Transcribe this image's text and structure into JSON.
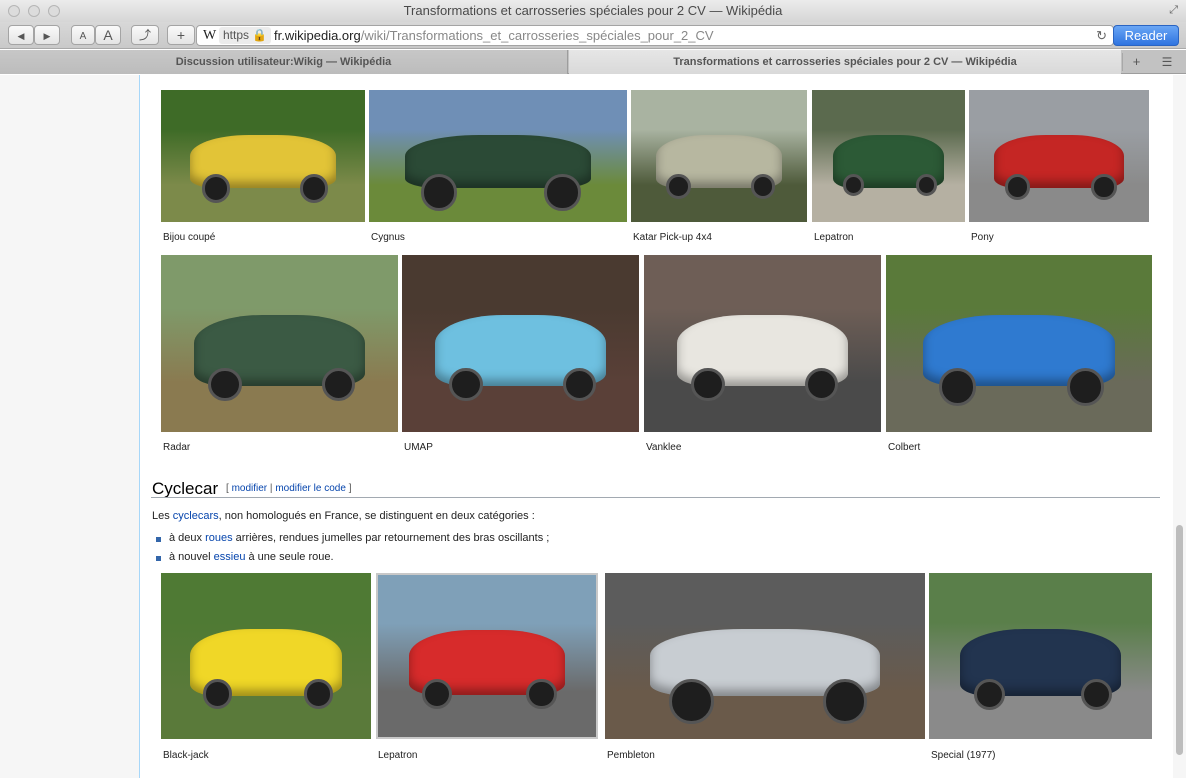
{
  "window": {
    "title": "Transformations et carrosseries spéciales pour 2 CV — Wikipédia"
  },
  "toolbar": {
    "back_icon": "◀",
    "forward_icon": "▶",
    "font_smaller": "A",
    "font_larger": "A",
    "share_icon": "⤴",
    "add_icon": "+",
    "url_site_icon": "W",
    "url_https": "https 🔒",
    "url_domain": "fr.wikipedia.org",
    "url_path": "/wiki/Transformations_et_carrosseries_spéciales_pour_2_CV",
    "reload_icon": "↻",
    "reader_label": "Reader"
  },
  "tabs": [
    {
      "label": "Discussion utilisateur:Wikig — Wikipédia",
      "active": false
    },
    {
      "label": "Transformations et carrosseries spéciales pour 2 CV — Wikipédia",
      "active": true
    }
  ],
  "tabbar": {
    "add_icon": "+",
    "list_icon": "☰"
  },
  "gallery_top": [
    {
      "caption": "Bijou coupé",
      "colors": [
        "#3e6b27",
        "#e2c437",
        "#7c8a4a"
      ]
    },
    {
      "caption": "Cygnus",
      "colors": [
        "#6f8fb6",
        "#2b4a36",
        "#6b8a3a"
      ]
    },
    {
      "caption": "Katar Pick-up 4x4",
      "colors": [
        "#a9b3a1",
        "#b7b7a0",
        "#4e5a3a"
      ]
    },
    {
      "caption": "Lepatron",
      "colors": [
        "#5b6a4e",
        "#2c5a36",
        "#b5b0a2"
      ]
    },
    {
      "caption": "Pony",
      "colors": [
        "#9a9ea3",
        "#c52624",
        "#8a8a8a"
      ]
    }
  ],
  "gallery_mid": [
    {
      "caption": "Radar",
      "colors": [
        "#7f9a6a",
        "#3b5a44",
        "#8a7a50"
      ]
    },
    {
      "caption": "UMAP",
      "colors": [
        "#4a3a30",
        "#6ec0e0",
        "#5a4038"
      ]
    },
    {
      "caption": "Vanklee",
      "colors": [
        "#6e5e56",
        "#e8e6e0",
        "#4a4a4a"
      ]
    },
    {
      "caption": "Colbert",
      "colors": [
        "#5a7a3a",
        "#2f7ad0",
        "#6a6a5a"
      ]
    }
  ],
  "section": {
    "heading": "Cyclecar",
    "edit_open": "[",
    "edit_modifier": "modifier",
    "edit_sep": "|",
    "edit_code": "modifier le code",
    "edit_close": "]",
    "intro_pre": "Les ",
    "intro_link": "cyclecars",
    "intro_post": ", non homologués en France, se distinguent en deux catégories :",
    "bullets": [
      {
        "pre": "à deux ",
        "link": "roues",
        "post": " arrières, rendues jumelles par retournement des bras oscillants ;"
      },
      {
        "pre": "à nouvel ",
        "link": "essieu",
        "post": " à une seule roue."
      }
    ]
  },
  "gallery_bottom": [
    {
      "caption": "Black-jack",
      "colors": [
        "#4f7a34",
        "#f0d727",
        "#5a7a3a"
      ]
    },
    {
      "caption": "Lepatron",
      "colors": [
        "#7fa0b8",
        "#d72b2b",
        "#6a6a6a"
      ]
    },
    {
      "caption": "Pembleton",
      "colors": [
        "#5c5c5c",
        "#c8cdd2",
        "#6a5a4a"
      ]
    },
    {
      "caption": "Special (1977)",
      "colors": [
        "#5a7f4a",
        "#22344f",
        "#8a8a8a"
      ]
    }
  ]
}
